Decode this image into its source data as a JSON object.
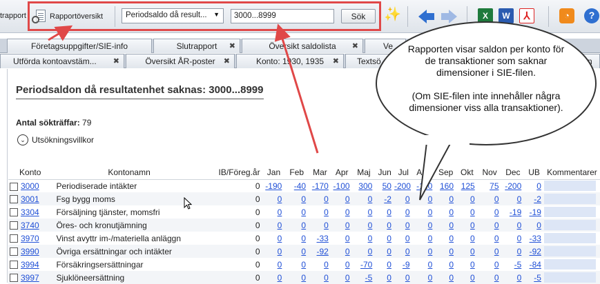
{
  "toolbar": {
    "partial_left_label": "trapport",
    "report_overview_label": "Rapportöversikt",
    "report_select_value": "Periodsaldo då result...",
    "range_input_value": "3000...8999",
    "search_button_label": "Sök"
  },
  "tabs_row1": [
    {
      "label": "Företagsuppgifter/SIE-info",
      "closable": false
    },
    {
      "label": "Slutrapport",
      "closable": true
    },
    {
      "label": "Översikt saldolista",
      "closable": true
    },
    {
      "label": "Ve",
      "closable": false
    }
  ],
  "tabs_row2": [
    {
      "label": "Utförda kontoavstäm...",
      "closable": true
    },
    {
      "label": "Översikt ÅR-poster",
      "closable": true
    },
    {
      "label": "Konto: 1930, 1935",
      "closable": true
    },
    {
      "label": "Textsö",
      "closable": false
    },
    {
      "label": "n",
      "closable": false
    }
  ],
  "report": {
    "title": "Periodsaldon då resultatenhet saknas: 3000...8999",
    "hits_label": "Antal sökträffar:",
    "hits_value": "79",
    "search_conditions_label": "Utsökningsvillkor"
  },
  "table": {
    "columns": [
      "Konto",
      "Kontonamn",
      "IB/Föreg.år",
      "Jan",
      "Feb",
      "Mar",
      "Apr",
      "Maj",
      "Jun",
      "Jul",
      "Aug",
      "Sep",
      "Okt",
      "Nov",
      "Dec",
      "UB",
      "Kommentarer"
    ],
    "rows": [
      {
        "konto": "3000",
        "namn": "Periodiserade intäkter",
        "ib": "0",
        "vals": [
          "-190",
          "-40",
          "-170",
          "-100",
          "300",
          "50",
          "-200",
          "-110",
          "160",
          "125",
          "75",
          "-200",
          "0"
        ]
      },
      {
        "konto": "3001",
        "namn": "Fsg bygg moms",
        "ib": "0",
        "vals": [
          "0",
          "0",
          "0",
          "0",
          "0",
          "-2",
          "0",
          "0",
          "0",
          "0",
          "0",
          "0",
          "-2"
        ]
      },
      {
        "konto": "3304",
        "namn": "Försäljning tjänster, momsfri",
        "ib": "0",
        "vals": [
          "0",
          "0",
          "0",
          "0",
          "0",
          "0",
          "0",
          "0",
          "0",
          "0",
          "0",
          "-19",
          "-19"
        ]
      },
      {
        "konto": "3740",
        "namn": "Öres- och kronutjämning",
        "ib": "0",
        "vals": [
          "0",
          "0",
          "0",
          "0",
          "0",
          "0",
          "0",
          "0",
          "0",
          "0",
          "0",
          "0",
          "0"
        ]
      },
      {
        "konto": "3970",
        "namn": "Vinst avyttr im-/materiella anläggn",
        "ib": "0",
        "vals": [
          "0",
          "0",
          "-33",
          "0",
          "0",
          "0",
          "0",
          "0",
          "0",
          "0",
          "0",
          "0",
          "-33"
        ]
      },
      {
        "konto": "3990",
        "namn": "Övriga ersättningar och intäkter",
        "ib": "0",
        "vals": [
          "0",
          "0",
          "-92",
          "0",
          "0",
          "0",
          "0",
          "0",
          "0",
          "0",
          "0",
          "0",
          "-92"
        ]
      },
      {
        "konto": "3994",
        "namn": "Försäkringsersättningar",
        "ib": "0",
        "vals": [
          "0",
          "0",
          "0",
          "0",
          "-70",
          "0",
          "-9",
          "0",
          "0",
          "0",
          "0",
          "-5",
          "-84"
        ]
      },
      {
        "konto": "3997",
        "namn": "Sjuklöneersättning",
        "ib": "0",
        "vals": [
          "0",
          "0",
          "0",
          "0",
          "-5",
          "0",
          "0",
          "0",
          "0",
          "0",
          "0",
          "0",
          "-5"
        ]
      }
    ]
  },
  "callout": {
    "line1": "Rapporten visar saldon per konto för de transaktioner som saknar dimensioner i SIE-filen.",
    "line2": "(Om SIE-filen inte innehåller några dimensioner viss alla transaktioner)."
  },
  "colors": {
    "highlight_box": "#e04848",
    "link": "#1f4fd6",
    "comment_cell": "#dde6f6"
  }
}
